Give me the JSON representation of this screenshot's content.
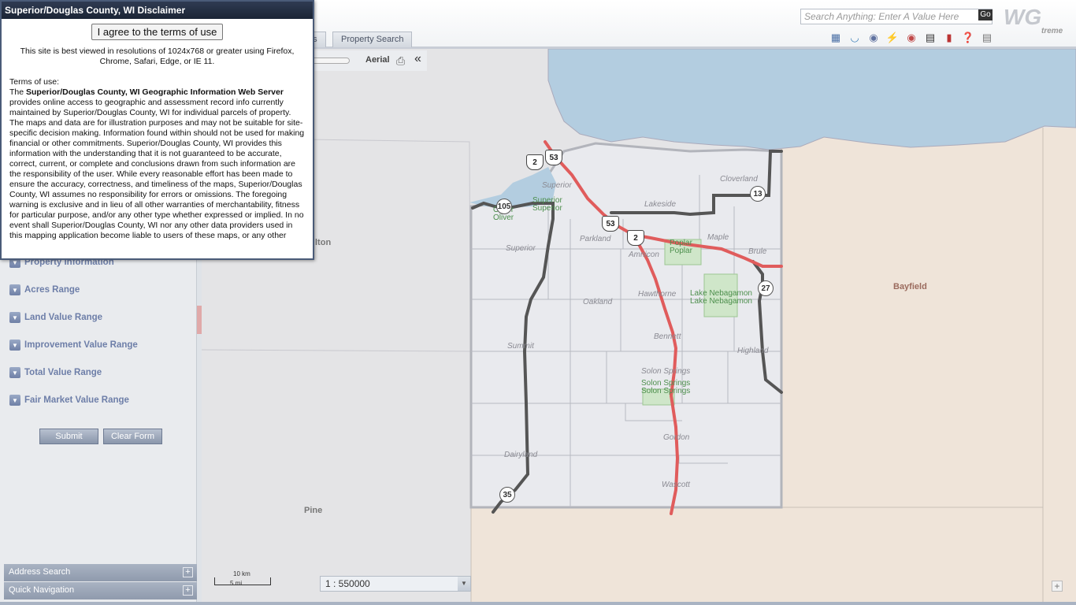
{
  "dialog": {
    "title": "Superior/Douglas County, WI Disclaimer",
    "agree_label": "I agree to the terms of use",
    "browser_note": "This site is best viewed in resolutions of 1024x768 or greater using Firefox, Chrome, Safari, Edge, or IE 11.",
    "terms_heading": "Terms of use:",
    "terms_intro": "The ",
    "terms_bold": "Superior/Douglas County, WI Geographic Information Web Server",
    "terms_body": " provides online access to geographic and assessment record info currently maintained by Superior/Douglas County, WI for individual parcels of property. The maps and data are for illustration purposes and may not be suitable for site-specific decision making. Information found within should not be used for making financial or other commitments. Superior/Douglas County, WI provides this information with the understanding that it is not guaranteed to be accurate, correct, current, or complete and conclusions drawn from such information are the responsibility of the user. While every reasonable effort has been made to ensure the accuracy, correctness, and timeliness of the maps, Superior/Douglas County, WI assumes no responsibility for errors or omissions. The foregoing warning is exclusive and in lieu of all other warranties of merchantability, fitness for particular purpose, and/or any other type whether expressed or implied. In no event shall Superior/Douglas County, WI nor any other data providers used in this mapping application become liable to users of these maps, or any other"
  },
  "header": {
    "search_placeholder": "Search Anything: Enter A Value Here",
    "go_label": "Go",
    "logo_text": "WG",
    "logo_sub": "treme",
    "tabs": [
      "ps",
      "Property Search"
    ],
    "aerial_label": "Aerial",
    "toolbar_icons": [
      "layers-icon",
      "measure-icon",
      "globe-icon",
      "lightning-icon",
      "identify-icon",
      "streetview-icon",
      "bookmark-icon",
      "help-icon",
      "print-layout-icon"
    ]
  },
  "left_panel": {
    "filters": [
      "Property Information",
      "Acres Range",
      "Land Value Range",
      "Improvement Value Range",
      "Total Value Range",
      "Fair Market Value Range"
    ],
    "submit_label": "Submit",
    "clear_label": "Clear Form",
    "accordions": [
      "Address Search",
      "Quick Navigation"
    ]
  },
  "map": {
    "region_labels": [
      "Pine",
      "Bayfield",
      "lton"
    ],
    "town_labels": [
      "Superior",
      "Cloverland",
      "Lakeside",
      "Parkland",
      "Amnicon",
      "Maple",
      "Brule",
      "Superior",
      "Oakland",
      "Hawthorne",
      "Bennett",
      "Highland",
      "Summit",
      "Solon Springs",
      "Gordon",
      "Dairyland",
      "Wascott",
      "Superior"
    ],
    "green_labels": [
      "Oliver\nOliver",
      "Superior\nSuperior",
      "Poplar\nPoplar",
      "Lake Nebagamon\nLake Nebagamon",
      "Solon Springs\nSolon Springs"
    ],
    "state_shields": [
      "105",
      "13",
      "27",
      "35"
    ],
    "us_shields": [
      "2",
      "53",
      "53",
      "2"
    ],
    "scale_km": "10 km",
    "scale_mi": "5 mi",
    "scale_value": "1 : 550000",
    "zoom_plus": "+"
  },
  "colors": {
    "water": "#b3cde0",
    "highway_us": "#e05c5c",
    "highway_state": "#555555",
    "county_bg": "#f0e4d7"
  }
}
